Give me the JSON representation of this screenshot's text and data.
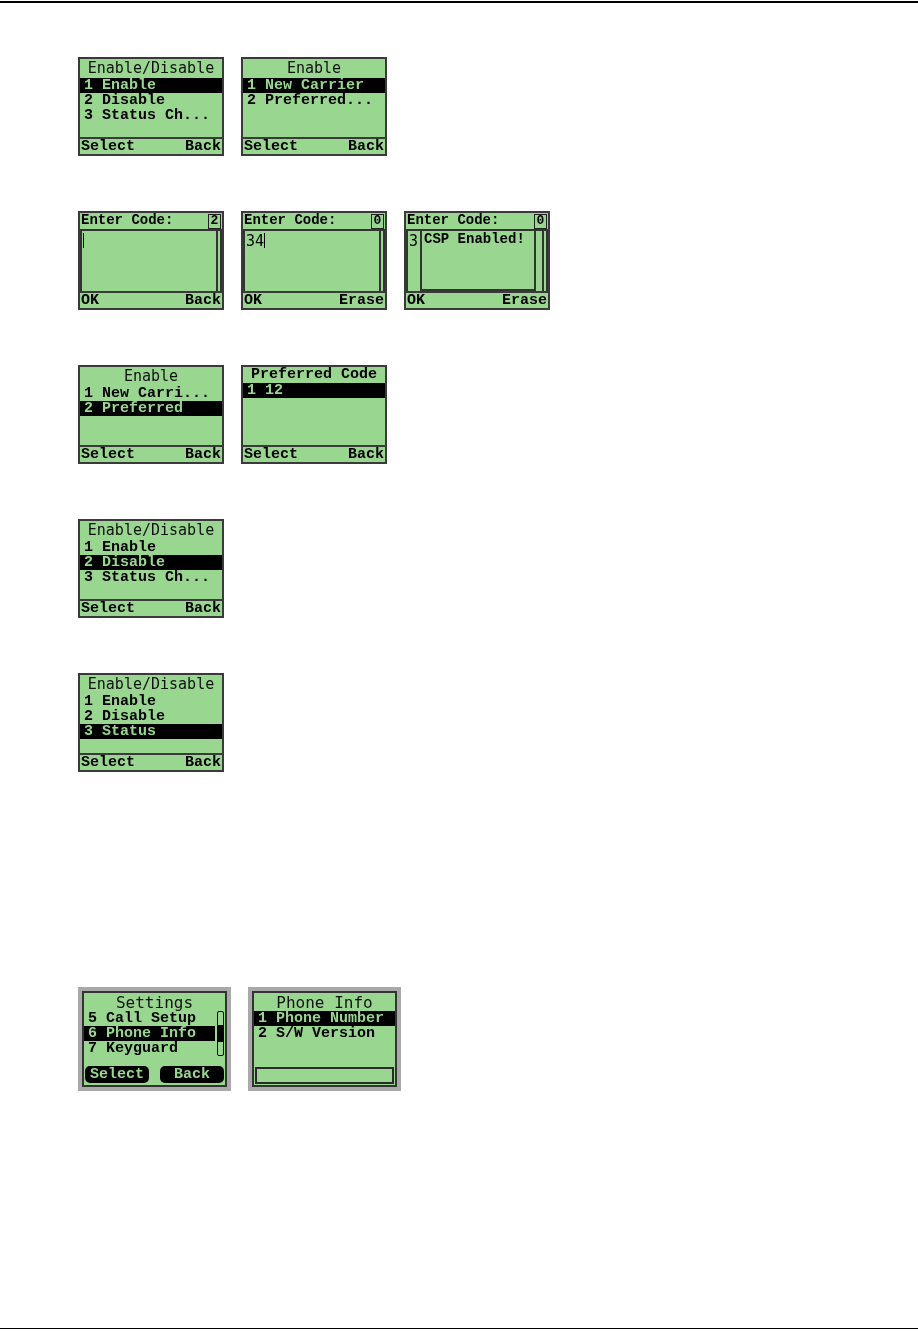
{
  "sections": [
    {
      "rows": [
        {
          "screens": [
            {
              "kind": "menu",
              "framed": false,
              "title": "Enable/Disable",
              "items": [
                {
                  "label": "1 Enable",
                  "selected": true
                },
                {
                  "label": "2 Disable",
                  "selected": false
                },
                {
                  "label": "3 Status Ch...",
                  "selected": false
                }
              ],
              "softkeys": [
                "Select",
                "Back"
              ]
            },
            {
              "kind": "menu",
              "framed": false,
              "title": "Enable",
              "items": [
                {
                  "label": "1 New Carrier",
                  "selected": true
                },
                {
                  "label": "2 Preferred...",
                  "selected": false
                }
              ],
              "softkeys": [
                "Select",
                "Back"
              ]
            }
          ]
        },
        {
          "screens": [
            {
              "kind": "code_entry",
              "framed": false,
              "title": "Enter Code:",
              "counter": "2",
              "cursor": true,
              "softkeys": [
                "OK",
                "Back"
              ]
            },
            {
              "kind": "code_entry",
              "framed": false,
              "title": "Enter Code:",
              "counter": "0",
              "value": "34",
              "cursor": true,
              "softkeys": [
                "OK",
                "Erase"
              ]
            },
            {
              "kind": "code_entry",
              "framed": false,
              "title": "Enter Code:",
              "counter": "0",
              "value": "3",
              "cursor": false,
              "popup": "CSP Enabled!",
              "softkeys": [
                "OK",
                "Erase"
              ]
            }
          ]
        },
        {
          "screens": [
            {
              "kind": "menu",
              "framed": false,
              "title": "Enable",
              "items": [
                {
                  "label": "1 New Carri...",
                  "selected": false
                },
                {
                  "label": "2 Preferred",
                  "selected": true
                }
              ],
              "softkeys": [
                "Select",
                "Back"
              ]
            },
            {
              "kind": "list",
              "framed": false,
              "title": "Preferred Code",
              "items": [
                {
                  "label": "1 12",
                  "selected": true
                }
              ],
              "softkeys": [
                "Select",
                "Back"
              ]
            }
          ]
        },
        {
          "screens": [
            {
              "kind": "menu",
              "framed": false,
              "title": "Enable/Disable",
              "items": [
                {
                  "label": "1 Enable",
                  "selected": false
                },
                {
                  "label": "2 Disable",
                  "selected": true
                },
                {
                  "label": "3 Status Ch...",
                  "selected": false
                }
              ],
              "softkeys": [
                "Select",
                "Back"
              ]
            }
          ]
        },
        {
          "screens": [
            {
              "kind": "menu",
              "framed": false,
              "title": "Enable/Disable",
              "items": [
                {
                  "label": "1 Enable",
                  "selected": false
                },
                {
                  "label": "2 Disable",
                  "selected": false
                },
                {
                  "label": "3 Status",
                  "selected": true
                }
              ],
              "softkeys": [
                "Select",
                "Back"
              ]
            }
          ]
        }
      ]
    },
    {
      "rows": [
        {
          "screens": [
            {
              "kind": "menu",
              "framed": true,
              "title": "Settings",
              "scrollbar": true,
              "items": [
                {
                  "label": "5 Call Setup",
                  "selected": false
                },
                {
                  "label": "6 Phone Info",
                  "selected": true
                },
                {
                  "label": "7 Keyguard",
                  "selected": false
                }
              ],
              "softkeys": [
                "Select",
                "Back"
              ]
            },
            {
              "kind": "menu",
              "framed": true,
              "title": "Phone Info",
              "scrollbar": false,
              "items": [
                {
                  "label": "1 Phone Number",
                  "selected": true
                },
                {
                  "label": "2 S/W Version",
                  "selected": false
                }
              ]
            }
          ]
        }
      ]
    }
  ]
}
